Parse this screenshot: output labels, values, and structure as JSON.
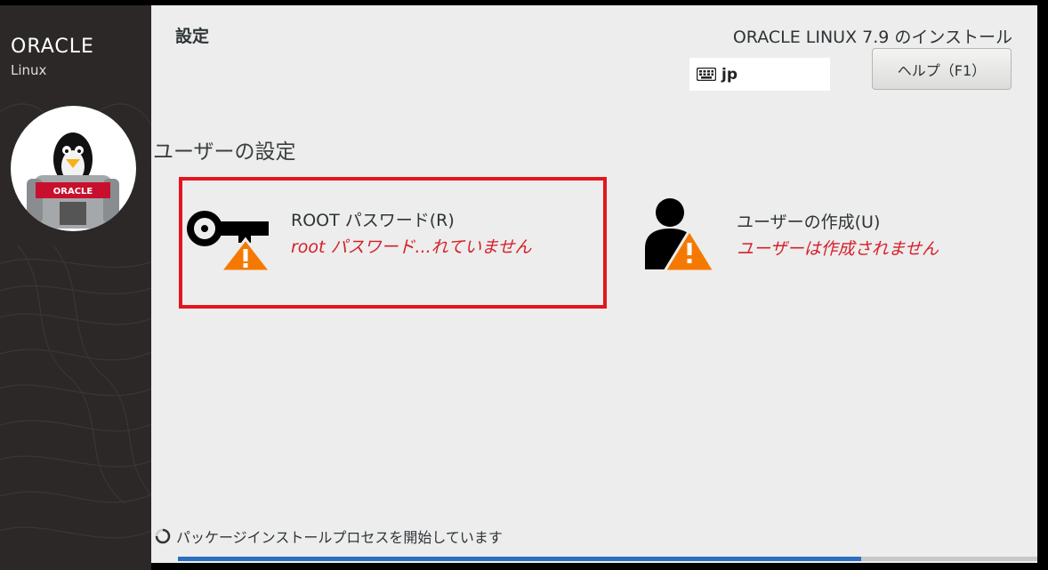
{
  "sidebar": {
    "brand": "ORACLE",
    "sub": "Linux",
    "avatar_badge": "ORACLE"
  },
  "header": {
    "title": "設定",
    "product": "ORACLE LINUX 7.9 のインストール",
    "keyboard_layout": "jp",
    "help_button": "ヘルプ（F1）"
  },
  "section": {
    "title": "ユーザーの設定"
  },
  "spokes": {
    "root": {
      "name": "ROOT パスワード(R)",
      "status": "root パスワード...れていません",
      "icon": "key-warning-icon"
    },
    "user": {
      "name": "ユーザーの作成(U)",
      "status": "ユーザーは作成されません",
      "icon": "user-warning-icon"
    }
  },
  "footer": {
    "status": "パッケージインストールプロセスを開始しています",
    "progress": 0.795
  },
  "colors": {
    "warning": "#f57900",
    "error_text": "#d5202a",
    "highlight_border": "#e2161e",
    "progress": "#2a6fc0"
  }
}
